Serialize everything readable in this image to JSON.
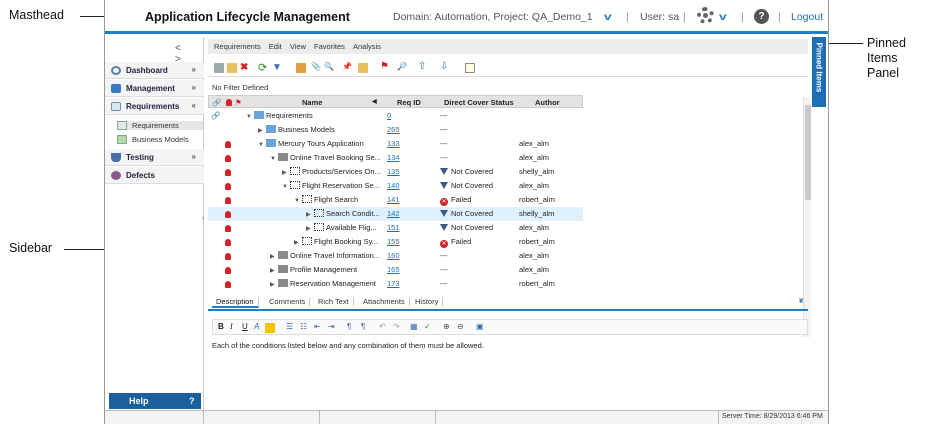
{
  "callouts": {
    "masthead": "Masthead",
    "pinned_items_panel": "Pinned\nItems\nPanel",
    "sidebar": "Sidebar"
  },
  "masthead": {
    "title": "Application Lifecycle Management",
    "domain_project": "Domain: Automation, Project: QA_Demo_1",
    "user": "User: sa",
    "logout": "Logout",
    "help_glyph": "?",
    "accent": "#1e7fc5"
  },
  "sidebar": {
    "nav_arrows": "< >",
    "items": [
      {
        "label": "Dashboard",
        "chevron": "»",
        "icon": "dashboard-icon",
        "color": "#5b7fa6"
      },
      {
        "label": "Management",
        "chevron": "»",
        "icon": "management-icon",
        "color": "#3a7bbf"
      },
      {
        "label": "Requirements",
        "chevron": "«",
        "icon": "requirements-icon",
        "color": "#6b8fb5"
      },
      {
        "label": "Testing",
        "chevron": "»",
        "icon": "testing-icon",
        "color": "#4b6fa8"
      },
      {
        "label": "Defects",
        "chevron": "",
        "icon": "defects-icon",
        "color": "#8a5a8a"
      }
    ],
    "subitems": [
      {
        "label": "Requirements",
        "icon": "requirements-list-icon"
      },
      {
        "label": "Business Models",
        "icon": "business-models-icon"
      }
    ],
    "help_label": "Help",
    "help_glyph": "?"
  },
  "menubar": [
    "Requirements",
    "Edit",
    "View",
    "Favorites",
    "Analysis"
  ],
  "filter_text": "No Filter Defined",
  "grid": {
    "columns": [
      "Name",
      "Req ID",
      "Direct Cover Status",
      "Author"
    ],
    "rows": [
      {
        "name": "Requirements",
        "id": "0",
        "status": "---",
        "author": "",
        "lock": false,
        "attach": true
      },
      {
        "name": "Business Models",
        "id": "265",
        "status": "---",
        "author": "",
        "lock": false,
        "attach": false
      },
      {
        "name": "Mercury Tours Application",
        "id": "133",
        "status": "---",
        "author": "alex_alm",
        "lock": true,
        "attach": false
      },
      {
        "name": "Online Travel Booking Se...",
        "id": "134",
        "status": "---",
        "author": "alex_alm",
        "lock": true,
        "attach": false
      },
      {
        "name": "Products/Services On...",
        "id": "135",
        "status": "Not Covered",
        "author": "shelly_alm",
        "lock": true,
        "attach": false
      },
      {
        "name": "Flight Reservation Se...",
        "id": "140",
        "status": "Not Covered",
        "author": "alex_alm",
        "lock": true,
        "attach": false
      },
      {
        "name": "Flight Search",
        "id": "141",
        "status": "Failed",
        "author": "robert_alm",
        "lock": true,
        "attach": false
      },
      {
        "name": "Search Condit...",
        "id": "142",
        "status": "Not Covered",
        "author": "shelly_alm",
        "lock": true,
        "attach": false
      },
      {
        "name": "Available Flig...",
        "id": "151",
        "status": "Not Covered",
        "author": "alex_alm",
        "lock": true,
        "attach": false
      },
      {
        "name": "Flight Booking Sy...",
        "id": "155",
        "status": "Failed",
        "author": "robert_alm",
        "lock": true,
        "attach": false
      },
      {
        "name": "Online Travel Information...",
        "id": "160",
        "status": "---",
        "author": "alex_alm",
        "lock": true,
        "attach": false
      },
      {
        "name": "Profile Management",
        "id": "165",
        "status": "---",
        "author": "alex_alm",
        "lock": true,
        "attach": false
      },
      {
        "name": "Reservation Management",
        "id": "173",
        "status": "---",
        "author": "robert_alm",
        "lock": true,
        "attach": false
      }
    ]
  },
  "tabs": [
    "Description",
    "Comments",
    "Rich Text",
    "Attachments",
    "History"
  ],
  "tabs_collapse": "¥",
  "richtext_buttons": [
    "B",
    "I",
    "U",
    "A"
  ],
  "description_text": "Each of the conditions listed below and any combination of them must be allowed.",
  "pinned_label": "Pinned Items",
  "status_bar": {
    "server_time": "Server Time: 8/29/2013 6:46 PM"
  }
}
